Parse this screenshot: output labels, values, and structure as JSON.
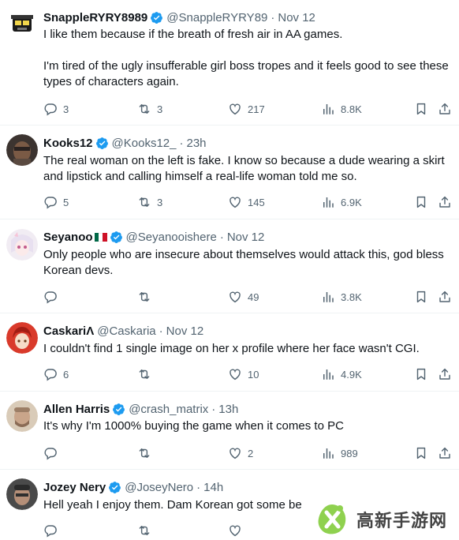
{
  "colors": {
    "accent": "#1d9bf0",
    "muted": "#536471",
    "text": "#0f1419",
    "divider": "#eff3f4"
  },
  "tweets": [
    {
      "name": "SnappleRYRY8989",
      "handle": "@SnappleRYRY89",
      "time": "Nov 12",
      "text": [
        "I like them because if the breath of fresh air in AA games.",
        "I'm tired of the ugly insufferable girl boss tropes and it feels good to see these types of characters again."
      ],
      "replies": "3",
      "reposts": "3",
      "likes": "217",
      "views": "8.8K"
    },
    {
      "name": "Kooks12",
      "handle": "@Kooks12_",
      "time": "23h",
      "text": [
        "The real woman on the left is fake. I know so because a dude wearing a skirt and lipstick and calling himself a real-life woman told me so."
      ],
      "replies": "5",
      "reposts": "3",
      "likes": "145",
      "views": "6.9K"
    },
    {
      "name": "Seyanoo",
      "handle": "@Seyanooishere",
      "time": "Nov 12",
      "text": [
        "Only people who are insecure about themselves would attack this, god bless Korean devs."
      ],
      "replies": "",
      "reposts": "",
      "likes": "49",
      "views": "3.8K"
    },
    {
      "name": "CaskariΛ",
      "handle": "@Caskaria",
      "time": "Nov 12",
      "text": [
        "I couldn't find 1 single image on her x profile where her face wasn't CGI."
      ],
      "replies": "6",
      "reposts": "",
      "likes": "10",
      "views": "4.9K"
    },
    {
      "name": "Allen Harris",
      "handle": "@crash_matrix",
      "time": "13h",
      "text": [
        "It's why I'm 1000% buying the game when it comes to PC"
      ],
      "replies": "",
      "reposts": "",
      "likes": "2",
      "views": "989"
    },
    {
      "name": "Jozey Nery",
      "handle": "@JoseyNero",
      "time": "14h",
      "text": [
        "Hell yeah I enjoy them. Dam Korean got some be"
      ],
      "replies": "",
      "reposts": "",
      "likes": "",
      "views": ""
    }
  ],
  "watermark": {
    "text": "高新手游网"
  },
  "icons": [
    "reply-icon",
    "repost-icon",
    "like-icon",
    "views-icon",
    "bookmark-icon",
    "share-icon",
    "verified-badge-icon",
    "mexico-flag-icon"
  ]
}
